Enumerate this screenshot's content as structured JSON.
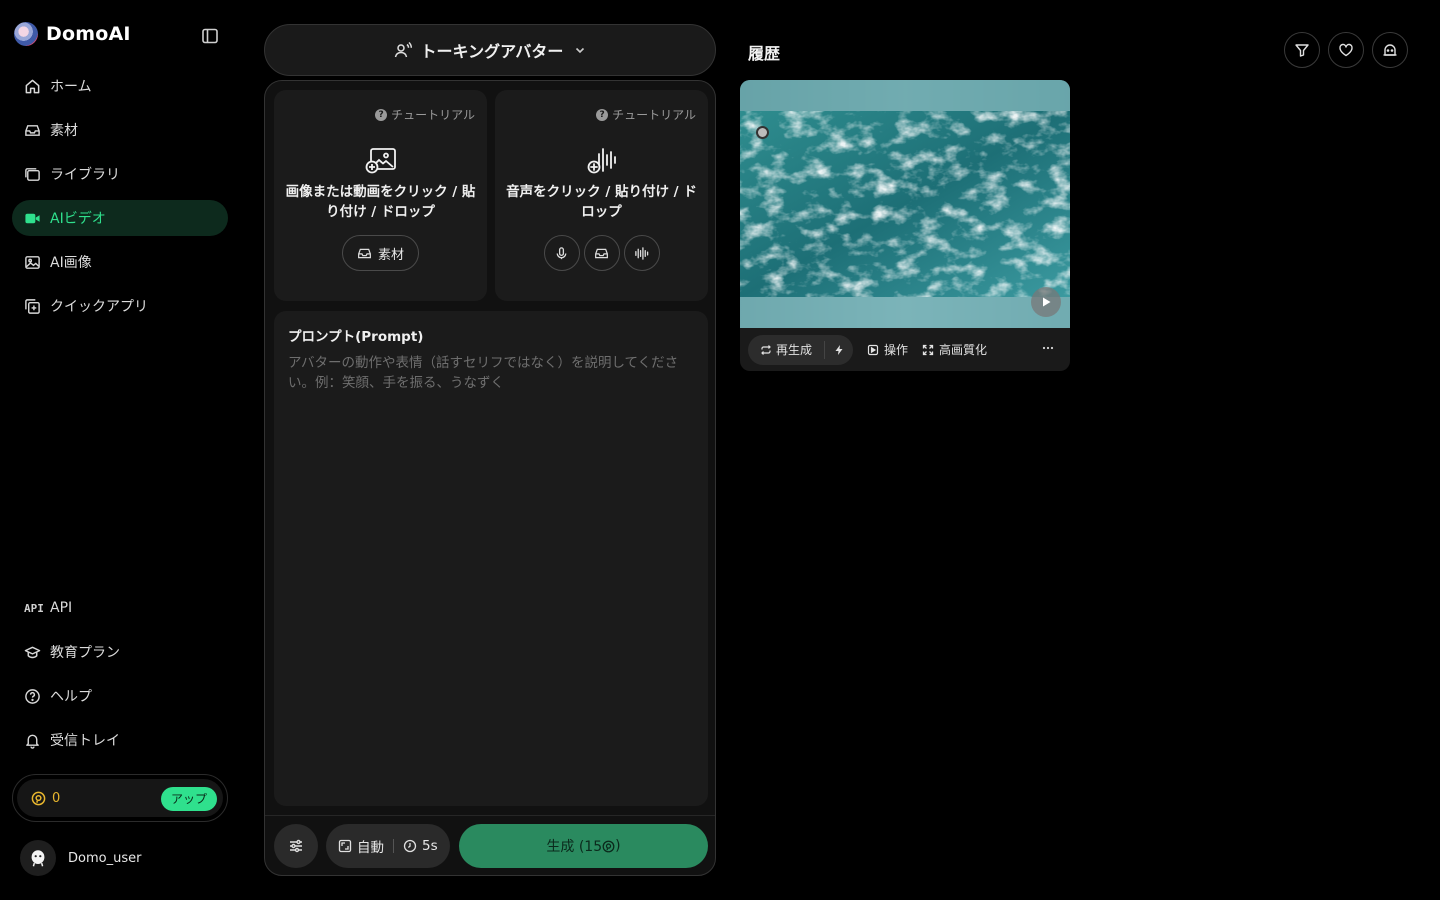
{
  "brand": {
    "name": "DomoAI"
  },
  "nav": {
    "items": [
      {
        "label": "ホーム",
        "icon": "home-icon"
      },
      {
        "label": "素材",
        "icon": "asset-icon"
      },
      {
        "label": "ライブラリ",
        "icon": "library-icon"
      },
      {
        "label": "AIビデオ",
        "icon": "video-icon",
        "active": true
      },
      {
        "label": "AI画像",
        "icon": "image-icon"
      },
      {
        "label": "クイックアプリ",
        "icon": "apps-icon"
      }
    ],
    "bottom": [
      {
        "label": "API",
        "icon": "api-icon",
        "tag": "API"
      },
      {
        "label": "教育プラン",
        "icon": "education-icon"
      },
      {
        "label": "ヘルプ",
        "icon": "help-icon"
      },
      {
        "label": "受信トレイ",
        "icon": "bell-icon"
      }
    ]
  },
  "credits": {
    "count": "0",
    "upgrade_label": "アップ"
  },
  "user": {
    "name": "Domo_user"
  },
  "mode": {
    "label": "トーキングアバター"
  },
  "upload": {
    "tutorial_label": "チュートリアル",
    "media_text": "画像または動画をクリック / 貼り付け / ドロップ",
    "media_chip": "素材",
    "audio_text": "音声をクリック / 貼り付け / ドロップ"
  },
  "prompt": {
    "label": "プロンプト(Prompt)",
    "value": "",
    "placeholder": "アバターの動作や表情（話すセリフではなく）を説明してください。例：笑顔、手を振る、うなずく"
  },
  "options": {
    "aspect": "自動",
    "duration": "5s"
  },
  "generate": {
    "label": "生成 (15",
    "suffix": ")"
  },
  "history": {
    "title": "履歴",
    "actions": {
      "regenerate": "再生成",
      "operate": "操作",
      "upscale": "高画質化"
    }
  },
  "colors": {
    "accent": "#2fe08d",
    "active_bg": "#0d2a1d",
    "generate_bg": "#2a8a5f",
    "coin": "#e8b62e"
  }
}
